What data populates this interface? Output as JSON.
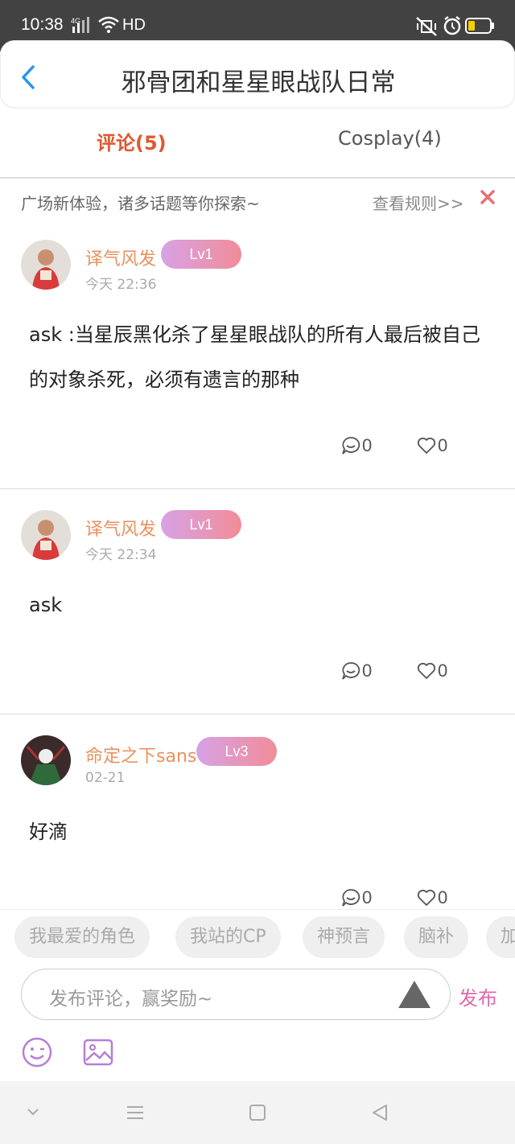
{
  "status_bar": {
    "time": "10:38",
    "network": "4G",
    "hd": "HD"
  },
  "header": {
    "title": "邪骨团和星星眼战队日常"
  },
  "tabs": [
    {
      "label": "评论(5)",
      "active": true
    },
    {
      "label": "Cosplay(4)",
      "active": false
    }
  ],
  "notice": {
    "text": "广场新体验，诸多话题等你探索~",
    "rules_link": "查看规则>>"
  },
  "posts": [
    {
      "username": "译气风发",
      "level": "Lv1",
      "time": "今天 22:36",
      "content": "ask :当星辰黑化杀了星星眼战队的所有人最后被自己的对象杀死，必须有遗言的那种",
      "comments": "0",
      "likes": "0"
    },
    {
      "username": "译气风发",
      "level": "Lv1",
      "time": "今天 22:34",
      "content": "ask",
      "comments": "0",
      "likes": "0"
    },
    {
      "username": "命定之下sans",
      "level": "Lv3",
      "time": "02-21",
      "content": "好滴",
      "comments": "0",
      "likes": "0"
    }
  ],
  "topic_chips": [
    "我最爱的角色",
    "我站的CP",
    "神预言",
    "脑补",
    "加"
  ],
  "composer": {
    "placeholder": "发布评论，赢奖励~",
    "publish_label": "发布"
  },
  "colors": {
    "accent_tab": "#e0582f",
    "username": "#e8925e",
    "publish": "#e069a9",
    "back_arrow": "#2196f3",
    "close_x": "#e8707a"
  }
}
